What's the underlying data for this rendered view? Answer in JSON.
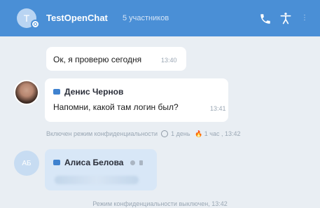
{
  "header": {
    "avatar_initial": "T",
    "title": "TestOpenChat",
    "subtitle": "5 участников"
  },
  "messages": [
    {
      "text": "Ок, я проверю сегодня",
      "time": "13:40"
    },
    {
      "sender": "Денис Чернов",
      "text": "Напомни, какой там логин был?",
      "time": "13:41"
    }
  ],
  "system_1": {
    "prefix": "Включен режим конфиденциальности",
    "timer_text": "1 день",
    "fire_icon": "🔥",
    "fire_text": "1 час , 13:42"
  },
  "alice": {
    "avatar_initials": "АБ",
    "sender": "Алиса Белова"
  },
  "system_2": "Режим конфиденциальности выключен, 13:42"
}
